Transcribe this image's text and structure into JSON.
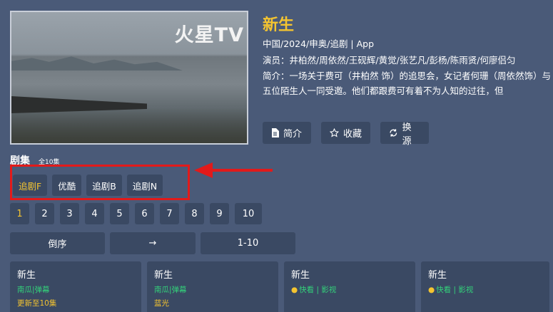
{
  "poster": {
    "watermark": "火星TV"
  },
  "detail": {
    "title": "新生",
    "meta": "中国/2024/申奥/追剧 | App",
    "actors": "演员：井柏然/周依然/王砚辉/黄觉/张艺凡/彭杨/陈雨贤/何廖侣匀",
    "desc": "简介：一场关于费可（井柏然 饰）的追思会，女记者何珊（周依然饰）与五位陌生人一同受邀。他们都跟费可有着不为人知的过往，但"
  },
  "actions": [
    {
      "label": "简介",
      "icon": "document-icon"
    },
    {
      "label": "收藏",
      "icon": "star-icon"
    },
    {
      "label": "换源",
      "icon": "refresh-icon"
    }
  ],
  "episodes": {
    "label": "剧集",
    "count": "全10集"
  },
  "sources": [
    {
      "label": "追剧F",
      "active": true
    },
    {
      "label": "优酷",
      "active": false
    },
    {
      "label": "追剧B",
      "active": false
    },
    {
      "label": "追剧N",
      "active": false
    }
  ],
  "pages": [
    "1",
    "2",
    "3",
    "4",
    "5",
    "6",
    "7",
    "8",
    "9",
    "10"
  ],
  "controls": {
    "reverse": "倒序",
    "arrow": "→",
    "range": "1-10"
  },
  "cards": [
    {
      "title": "新生",
      "line2": "南瓜|弹幕",
      "line3": "更新至10集"
    },
    {
      "title": "新生",
      "line2": "南瓜|弹幕",
      "line3": "蓝光"
    },
    {
      "title": "新生",
      "line2": "快看 | 影视",
      "line3": ""
    },
    {
      "title": "新生",
      "line2": "快看 | 影视",
      "line3": ""
    }
  ],
  "colors": {
    "accent": "#f4c430",
    "highlight": "#e21a1a",
    "green": "#33d17a"
  }
}
